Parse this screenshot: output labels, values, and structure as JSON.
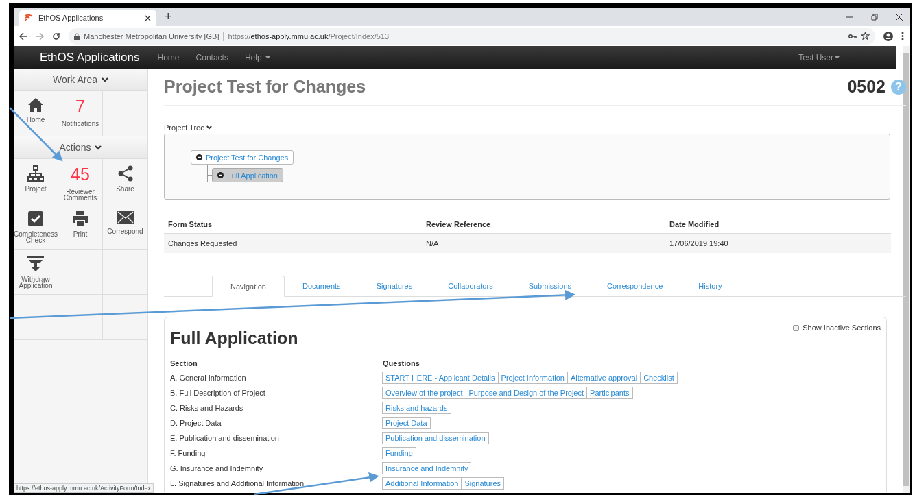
{
  "browser": {
    "tab_title": "EthOS Applications",
    "new_tab": "+",
    "site_identity": "Manchester Metropolitan University [GB]",
    "url_scheme": "https://",
    "url_host": "ethos-apply.mmu.ac.uk",
    "url_path": "/Project/Index/513"
  },
  "navbar": {
    "brand": "EthOS Applications",
    "links": [
      {
        "label": "Home",
        "dropdown": false
      },
      {
        "label": "Contacts",
        "dropdown": false
      },
      {
        "label": "Help",
        "dropdown": true
      }
    ],
    "user": "Test User"
  },
  "sidebar": {
    "sections": [
      {
        "title": "Work Area",
        "tiles": [
          {
            "kind": "icon",
            "label": "Home"
          },
          {
            "kind": "count",
            "count": "7",
            "label": "Notifications"
          }
        ]
      },
      {
        "title": "Actions",
        "tiles": [
          {
            "kind": "icon",
            "label": "Project"
          },
          {
            "kind": "count",
            "count": "45",
            "label": "Reviewer Comments"
          },
          {
            "kind": "icon",
            "label": "Share"
          },
          {
            "kind": "icon",
            "label": "Completeness Check"
          },
          {
            "kind": "icon",
            "label": "Print"
          },
          {
            "kind": "icon",
            "label": "Correspond"
          },
          {
            "kind": "icon",
            "label": "Withdraw Application"
          }
        ]
      }
    ]
  },
  "page": {
    "title": "Project Test for Changes",
    "number": "0502",
    "help": "?"
  },
  "project_tree": {
    "label": "Project Tree",
    "nodes": [
      {
        "label": "Project Test for Changes",
        "selected": false,
        "children": [
          {
            "label": "Full Application",
            "selected": true
          }
        ]
      }
    ]
  },
  "status_table": {
    "columns": [
      "Form Status",
      "Review Reference",
      "Date Modified"
    ],
    "rows": [
      [
        "Changes Requested",
        "N/A",
        "17/06/2019 19:40"
      ]
    ]
  },
  "tabs": [
    {
      "label": "Navigation",
      "selected": true
    },
    {
      "label": "Documents",
      "selected": false
    },
    {
      "label": "Signatures",
      "selected": false
    },
    {
      "label": "Collaborators",
      "selected": false
    },
    {
      "label": "Submissions",
      "selected": false
    },
    {
      "label": "Correspondence",
      "selected": false
    },
    {
      "label": "History",
      "selected": false
    }
  ],
  "form": {
    "title": "Full Application",
    "show_inactive": {
      "label": "Show Inactive Sections",
      "checked": false
    },
    "columns": [
      "Section",
      "Questions"
    ],
    "rows": [
      {
        "section": "A. General Information",
        "questions": [
          "START HERE - Applicant Details",
          "Project Information",
          "Alternative approval",
          "Checklist"
        ]
      },
      {
        "section": "B. Full Description of Project",
        "questions": [
          "Overview of the project",
          "Purpose and Design of the Project",
          "Participants"
        ]
      },
      {
        "section": "C. Risks and Hazards",
        "questions": [
          "Risks and hazards"
        ]
      },
      {
        "section": "D. Project Data",
        "questions": [
          "Project Data"
        ]
      },
      {
        "section": "E. Publication and dissemination",
        "questions": [
          "Publication and dissemination"
        ]
      },
      {
        "section": "F. Funding",
        "questions": [
          "Funding"
        ]
      },
      {
        "section": "G. Insurance and Indemnity",
        "questions": [
          "Insurance and Indemnity"
        ]
      },
      {
        "section": "L. Signatures and Additional Information",
        "questions": [
          "Additional Information",
          "Signatures"
        ]
      }
    ]
  },
  "status_bar": "https://ethos-apply.mmu.ac.uk/ActivityForm/Index"
}
